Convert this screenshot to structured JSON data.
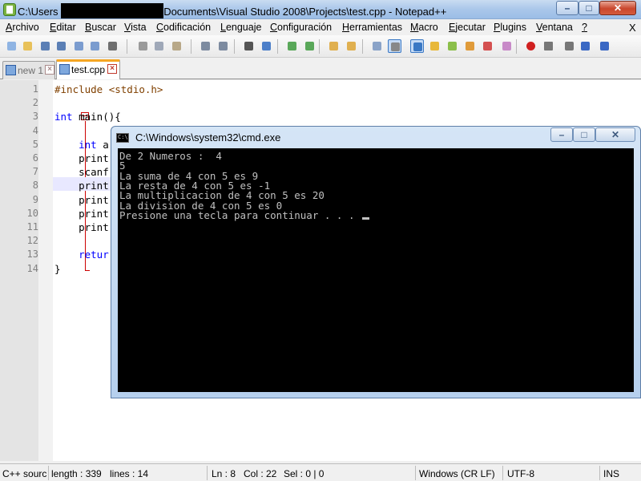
{
  "window": {
    "title_prefix": "C:\\Users",
    "title_suffix": "Documents\\Visual Studio 2008\\Projects\\test.cpp - Notepad++",
    "min_label": "–",
    "max_label": "□",
    "close_label": "✕"
  },
  "menu": {
    "items": [
      {
        "ul": "A",
        "rest": "rchivo"
      },
      {
        "ul": "E",
        "rest": "ditar"
      },
      {
        "ul": "B",
        "rest": "uscar"
      },
      {
        "ul": "V",
        "rest": "ista"
      },
      {
        "ul": "C",
        "rest": "odificación"
      },
      {
        "ul": "L",
        "rest": "enguaje"
      },
      {
        "ul": "C",
        "rest": "onfiguración"
      },
      {
        "ul": "H",
        "rest": "erramientas"
      },
      {
        "ul": "M",
        "rest": "acro"
      },
      {
        "ul": "E",
        "rest": "jecutar"
      },
      {
        "ul": "P",
        "rest": "lugins"
      },
      {
        "ul": "V",
        "rest": "entana"
      },
      {
        "ul": "?",
        "rest": ""
      }
    ],
    "close_label": "X"
  },
  "toolbar": {
    "icons": [
      "new-file-icon",
      "open-file-icon",
      "save-icon",
      "save-all-icon",
      "close-icon",
      "close-all-icon",
      "print-icon",
      "cut-icon",
      "copy-icon",
      "paste-icon",
      "undo-icon",
      "redo-icon",
      "find-icon",
      "replace-icon",
      "zoom-in-icon",
      "zoom-out-icon",
      "sync-vertical-icon",
      "sync-horizontal-icon",
      "word-wrap-icon",
      "show-all-chars-icon",
      "indent-guide-icon",
      "user-lang-icon",
      "doc-map-icon",
      "function-list-icon",
      "folder-workspace-icon",
      "monitor-icon",
      "record-macro-icon",
      "stop-record-icon",
      "play-macro-icon",
      "run-macro-multiple-icon",
      "save-macro-icon"
    ]
  },
  "tabs": [
    {
      "label": "new 1",
      "active": false
    },
    {
      "label": "test.cpp",
      "active": true
    }
  ],
  "editor": {
    "line_numbers": [
      "1",
      "2",
      "3",
      "4",
      "5",
      "6",
      "7",
      "8",
      "9",
      "10",
      "11",
      "12",
      "13",
      "14"
    ],
    "lines": [
      {
        "tokens": [
          {
            "cls": "pp",
            "text": "#include <stdio.h>"
          }
        ]
      },
      {
        "tokens": []
      },
      {
        "tokens": [
          {
            "cls": "kw",
            "text": "int"
          },
          {
            "cls": "",
            "text": " main(){"
          }
        ]
      },
      {
        "tokens": []
      },
      {
        "tokens": [
          {
            "cls": "",
            "text": "    "
          },
          {
            "cls": "kw",
            "text": "int"
          },
          {
            "cls": "",
            "text": " a"
          }
        ]
      },
      {
        "tokens": [
          {
            "cls": "",
            "text": "    print"
          }
        ]
      },
      {
        "tokens": [
          {
            "cls": "",
            "text": "    scanf"
          }
        ]
      },
      {
        "tokens": [
          {
            "cls": "",
            "text": "    print"
          }
        ]
      },
      {
        "tokens": [
          {
            "cls": "",
            "text": "    print"
          }
        ]
      },
      {
        "tokens": [
          {
            "cls": "",
            "text": "    print"
          }
        ]
      },
      {
        "tokens": [
          {
            "cls": "",
            "text": "    print"
          }
        ]
      },
      {
        "tokens": []
      },
      {
        "tokens": [
          {
            "cls": "",
            "text": "    "
          },
          {
            "cls": "kw",
            "text": "retur"
          }
        ]
      },
      {
        "tokens": [
          {
            "cls": "",
            "text": "}"
          }
        ]
      }
    ]
  },
  "status": {
    "lang": "C++ sourc",
    "length": "length : 339",
    "lines": "lines : 14",
    "ln": "Ln : 8",
    "col": "Col : 22",
    "sel": "Sel : 0 | 0",
    "eol": "Windows (CR LF)",
    "encoding": "UTF-8",
    "mode": "INS"
  },
  "cmd": {
    "title": "C:\\Windows\\system32\\cmd.exe",
    "min_label": "–",
    "max_label": "□",
    "close_label": "✕",
    "lines": [
      "De 2 Numeros :  4",
      "5",
      "La suma de 4 con 5 es 9",
      "La resta de 4 con 5 es -1",
      "La multiplicacion de 4 con 5 es 20",
      "La division de 4 con 5 es 0",
      "Presione una tecla para continuar . . . "
    ]
  },
  "colors": {
    "keyword": "#0000ff",
    "preprocessor": "#804000",
    "current_line": "#e8e8ff",
    "console_bg": "#000000",
    "console_text": "#c0c0c0"
  }
}
